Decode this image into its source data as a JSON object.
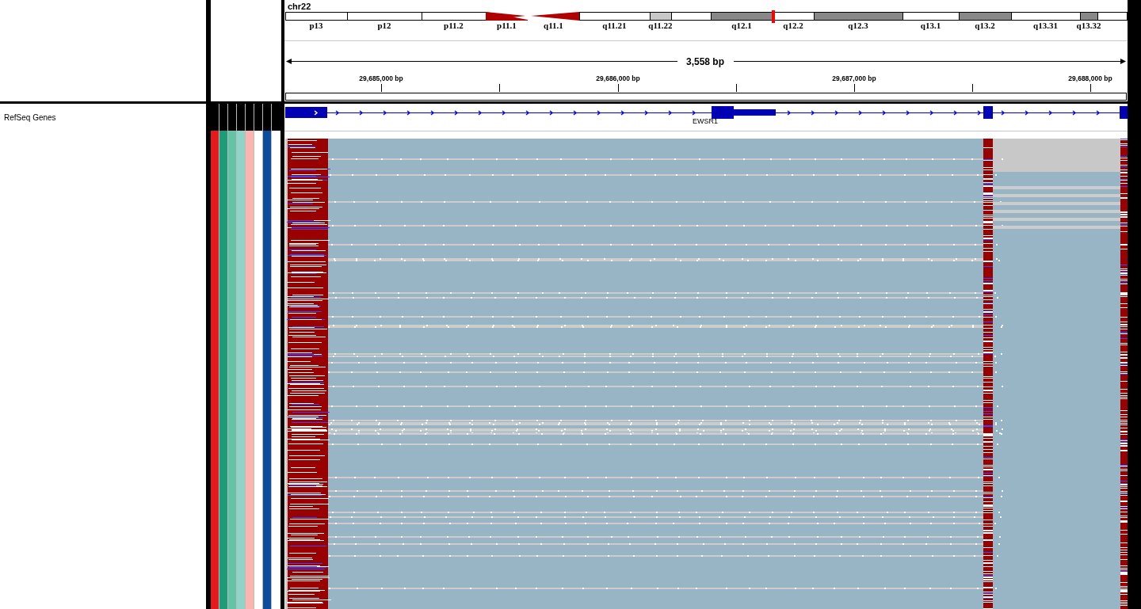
{
  "locus": {
    "chromosome": "chr22"
  },
  "ideogram": {
    "bands": [
      {
        "name": "p13",
        "kind": "gneg"
      },
      {
        "name": "p12",
        "kind": "gneg"
      },
      {
        "name": "p11.2",
        "kind": "gneg"
      },
      {
        "name": "p11.1",
        "kind": "acen_p"
      },
      {
        "name": "q11.1",
        "kind": "acen_q"
      },
      {
        "name": "q11.21",
        "kind": "gneg"
      },
      {
        "name": "q11.22",
        "kind": "gpos25"
      },
      {
        "kind": "gneg"
      },
      {
        "name": "q12.1",
        "kind": "gpos50"
      },
      {
        "name": "q12.2",
        "kind": "gneg"
      },
      {
        "name": "q12.3",
        "kind": "gpos50"
      },
      {
        "name": "q13.1",
        "kind": "gneg"
      },
      {
        "name": "q13.2",
        "kind": "gpos50"
      },
      {
        "name": "q13.31",
        "kind": "gneg"
      },
      {
        "name": "q13.32",
        "kind": "gpos50"
      },
      {
        "kind": "gneg"
      }
    ]
  },
  "ruler": {
    "span": "3,558 bp",
    "ticks": [
      {
        "label": "29,685,000 bp"
      },
      {
        "label": "29,686,000 bp"
      },
      {
        "label": "29,687,000 bp"
      },
      {
        "label": "29,688,000 bp"
      }
    ]
  },
  "tracks": [
    {
      "name": "RefSeq Genes"
    }
  ],
  "gene_track": {
    "gene": "EWSR1"
  },
  "attribute_columns": [
    {
      "color": "#e41a1c"
    },
    {
      "color": "#1b9e77"
    },
    {
      "color": "#66c2a5"
    },
    {
      "color": "#8fd4c8"
    },
    {
      "color": "#fbb4ae"
    },
    {
      "color": "#ffffff"
    },
    {
      "color": "#0b4d9a"
    },
    {
      "color": "#ffffff"
    }
  ]
}
